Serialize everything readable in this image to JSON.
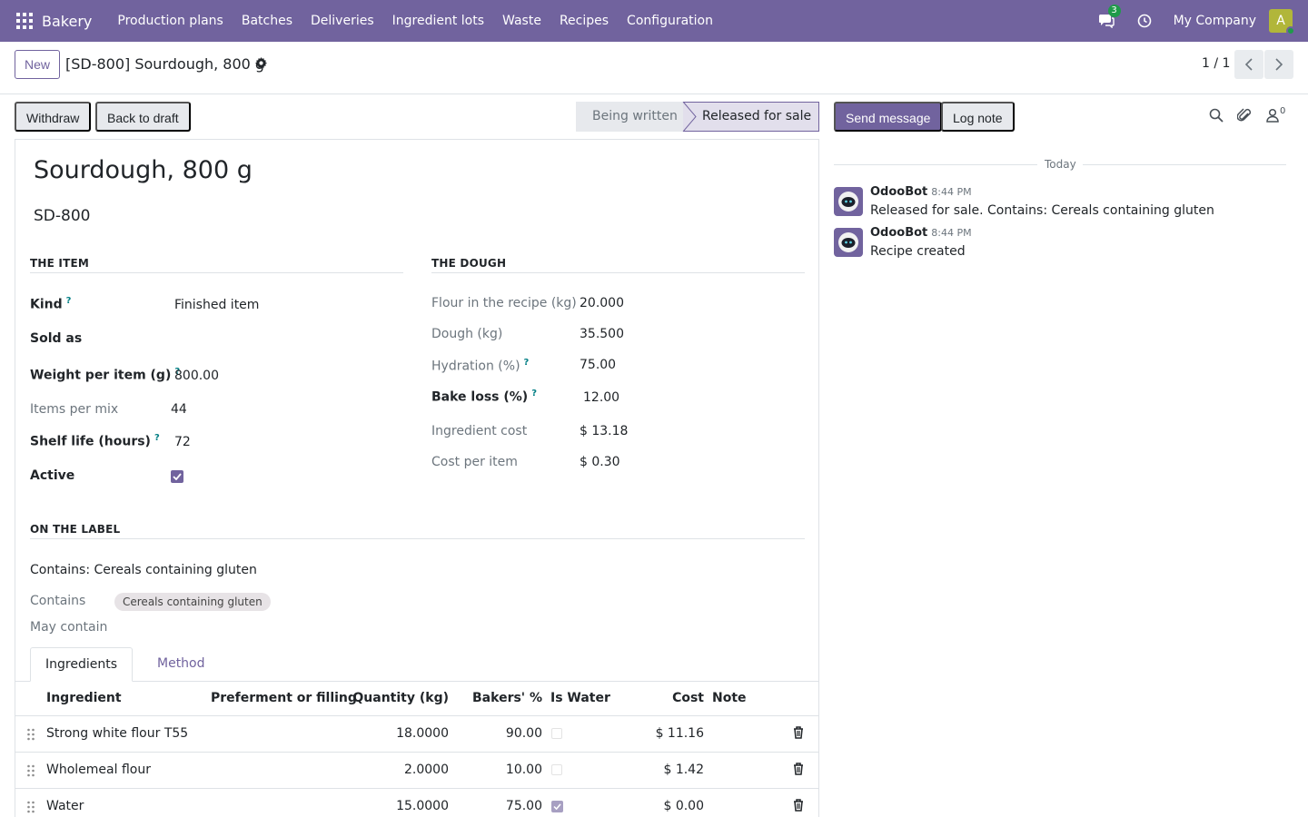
{
  "navbar": {
    "app_name": "Bakery",
    "menu": [
      "Production plans",
      "Batches",
      "Deliveries",
      "Ingredient lots",
      "Waste",
      "Recipes",
      "Configuration"
    ],
    "messages_count": "3",
    "company": "My Company",
    "avatar_letter": "A",
    "brand_color": "#71639e"
  },
  "control": {
    "new_label": "New",
    "title": "[SD-800] Sourdough, 800 g",
    "pager": "1 / 1"
  },
  "statusbar": {
    "withdraw_label": "Withdraw",
    "back_to_draft_label": "Back to draft",
    "stage_1": "Being written",
    "stage_2": "Released for sale",
    "current_stage": "Released for sale"
  },
  "form": {
    "name": "Sourdough, 800 g",
    "reference": "SD-800",
    "item_group": {
      "heading": "THE ITEM",
      "kind_label": "Kind",
      "kind_value": "Finished item",
      "sold_as_label": "Sold as",
      "weight_label": "Weight per item (g)",
      "weight_value": "800.00",
      "items_per_mix_label": "Items per mix",
      "items_per_mix_value": "44",
      "shelf_life_label": "Shelf life (hours)",
      "shelf_life_value": "72",
      "active_label": "Active",
      "active": true
    },
    "dough_group": {
      "heading": "THE DOUGH",
      "flour_label": "Flour in the recipe (kg)",
      "flour_value": "20.000",
      "dough_label": "Dough (kg)",
      "dough_value": "35.500",
      "hydration_label": "Hydration (%)",
      "hydration_value": "75.00",
      "bake_loss_label": "Bake loss (%)",
      "bake_loss_value": "12.00",
      "ingredient_cost_label": "Ingredient cost",
      "ingredient_cost_value": "$ 13.18",
      "cost_per_item_label": "Cost per item",
      "cost_per_item_value": "$ 0.30"
    },
    "label_group": {
      "heading": "ON THE LABEL",
      "statement": "Contains: Cereals containing gluten",
      "contains_label": "Contains",
      "contains_tag": "Cereals containing gluten",
      "may_contain_label": "May contain"
    },
    "tabs": [
      "Ingredients",
      "Method"
    ],
    "active_tab": "Ingredients",
    "table": {
      "headers": {
        "ingredient": "Ingredient",
        "preferment": "Preferment or filling",
        "quantity": "Quantity (kg)",
        "bakers_pct": "Bakers' %",
        "is_water": "Is Water",
        "cost": "Cost",
        "note": "Note"
      },
      "rows": [
        {
          "ingredient": "Strong white flour T55",
          "preferment": "",
          "quantity": "18.0000",
          "bakers_pct": "90.00",
          "is_water": false,
          "cost": "$ 11.16",
          "note": ""
        },
        {
          "ingredient": "Wholemeal flour",
          "preferment": "",
          "quantity": "2.0000",
          "bakers_pct": "10.00",
          "is_water": false,
          "cost": "$ 1.42",
          "note": ""
        },
        {
          "ingredient": "Water",
          "preferment": "",
          "quantity": "15.0000",
          "bakers_pct": "75.00",
          "is_water": true,
          "cost": "$ 0.00",
          "note": ""
        }
      ]
    }
  },
  "chatter": {
    "send_message_label": "Send message",
    "log_note_label": "Log note",
    "followers_count": "0",
    "date_separator": "Today",
    "messages": [
      {
        "author": "OdooBot",
        "time": "8:44 PM",
        "body": "Released for sale. Contains: Cereals containing gluten"
      },
      {
        "author": "OdooBot",
        "time": "8:44 PM",
        "body": "Recipe created"
      }
    ]
  }
}
